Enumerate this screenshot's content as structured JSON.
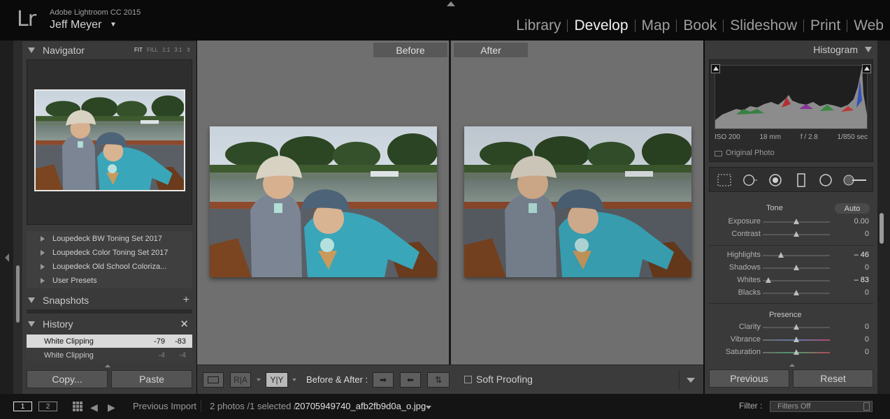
{
  "app": {
    "logo": "Lr",
    "name": "Adobe Lightroom CC 2015",
    "user": "Jeff Meyer"
  },
  "modules": [
    {
      "label": "Library",
      "active": false
    },
    {
      "label": "Develop",
      "active": true
    },
    {
      "label": "Map",
      "active": false
    },
    {
      "label": "Book",
      "active": false
    },
    {
      "label": "Slideshow",
      "active": false
    },
    {
      "label": "Print",
      "active": false
    },
    {
      "label": "Web",
      "active": false
    }
  ],
  "left": {
    "navigator": {
      "title": "Navigator",
      "zoom_options": [
        "FIT",
        "FILL",
        "1:1",
        "3:1"
      ],
      "zoom_selected": "FIT"
    },
    "presets": [
      "Loupedeck BW Toning Set 2017",
      "Loupedeck Color Toning Set 2017",
      "Loupedeck Old School Coloriza...",
      "User Presets"
    ],
    "snapshots_title": "Snapshots",
    "history_title": "History",
    "history": [
      {
        "name": "White Clipping",
        "v1": "-79",
        "v2": "-83",
        "selected": true
      },
      {
        "name": "White Clipping",
        "v1": "-4",
        "v2": "-4",
        "selected": false
      }
    ],
    "copy_label": "Copy...",
    "paste_label": "Paste"
  },
  "center": {
    "before_label": "Before",
    "after_label": "After"
  },
  "toolbar": {
    "view_icon": "loupe-view-icon",
    "ra_label": "R|A",
    "yy_label": "Y|Y",
    "before_after_label": "Before & After :",
    "soft_proofing_label": "Soft Proofing"
  },
  "right": {
    "histogram_title": "Histogram",
    "exif": {
      "iso": "ISO 200",
      "focal": "18 mm",
      "aperture": "f / 2.8",
      "shutter": "1/850 sec"
    },
    "original_photo_label": "Original Photo",
    "tone_title": "Tone",
    "auto_label": "Auto",
    "presence_title": "Presence",
    "sliders": [
      {
        "label": "Exposure",
        "value": "0.00",
        "pos": 0.5,
        "bold": false
      },
      {
        "label": "Contrast",
        "value": "0",
        "pos": 0.5,
        "bold": false
      },
      {
        "label": "Highlights",
        "value": "– 46",
        "pos": 0.27,
        "bold": true
      },
      {
        "label": "Shadows",
        "value": "0",
        "pos": 0.5,
        "bold": false
      },
      {
        "label": "Whites",
        "value": "– 83",
        "pos": 0.085,
        "bold": true
      },
      {
        "label": "Blacks",
        "value": "0",
        "pos": 0.5,
        "bold": false
      },
      {
        "label": "Clarity",
        "value": "0",
        "pos": 0.5,
        "bold": false
      },
      {
        "label": "Vibrance",
        "value": "0",
        "pos": 0.5,
        "bold": false
      },
      {
        "label": "Saturation",
        "value": "0",
        "pos": 0.5,
        "bold": false
      }
    ],
    "previous_label": "Previous",
    "reset_label": "Reset"
  },
  "filmstrip": {
    "view1": "1",
    "view2": "2",
    "source": "Previous Import",
    "count": "2 photos /1 selected /",
    "filename": "20705949740_afb2fb9d0a_o.jpg",
    "filter_label": "Filter :",
    "filter_value": "Filters Off"
  },
  "colors": {
    "accent": "#e8e8e8",
    "panel": "#3a3a3a",
    "workspace": "#6f6f6f"
  }
}
